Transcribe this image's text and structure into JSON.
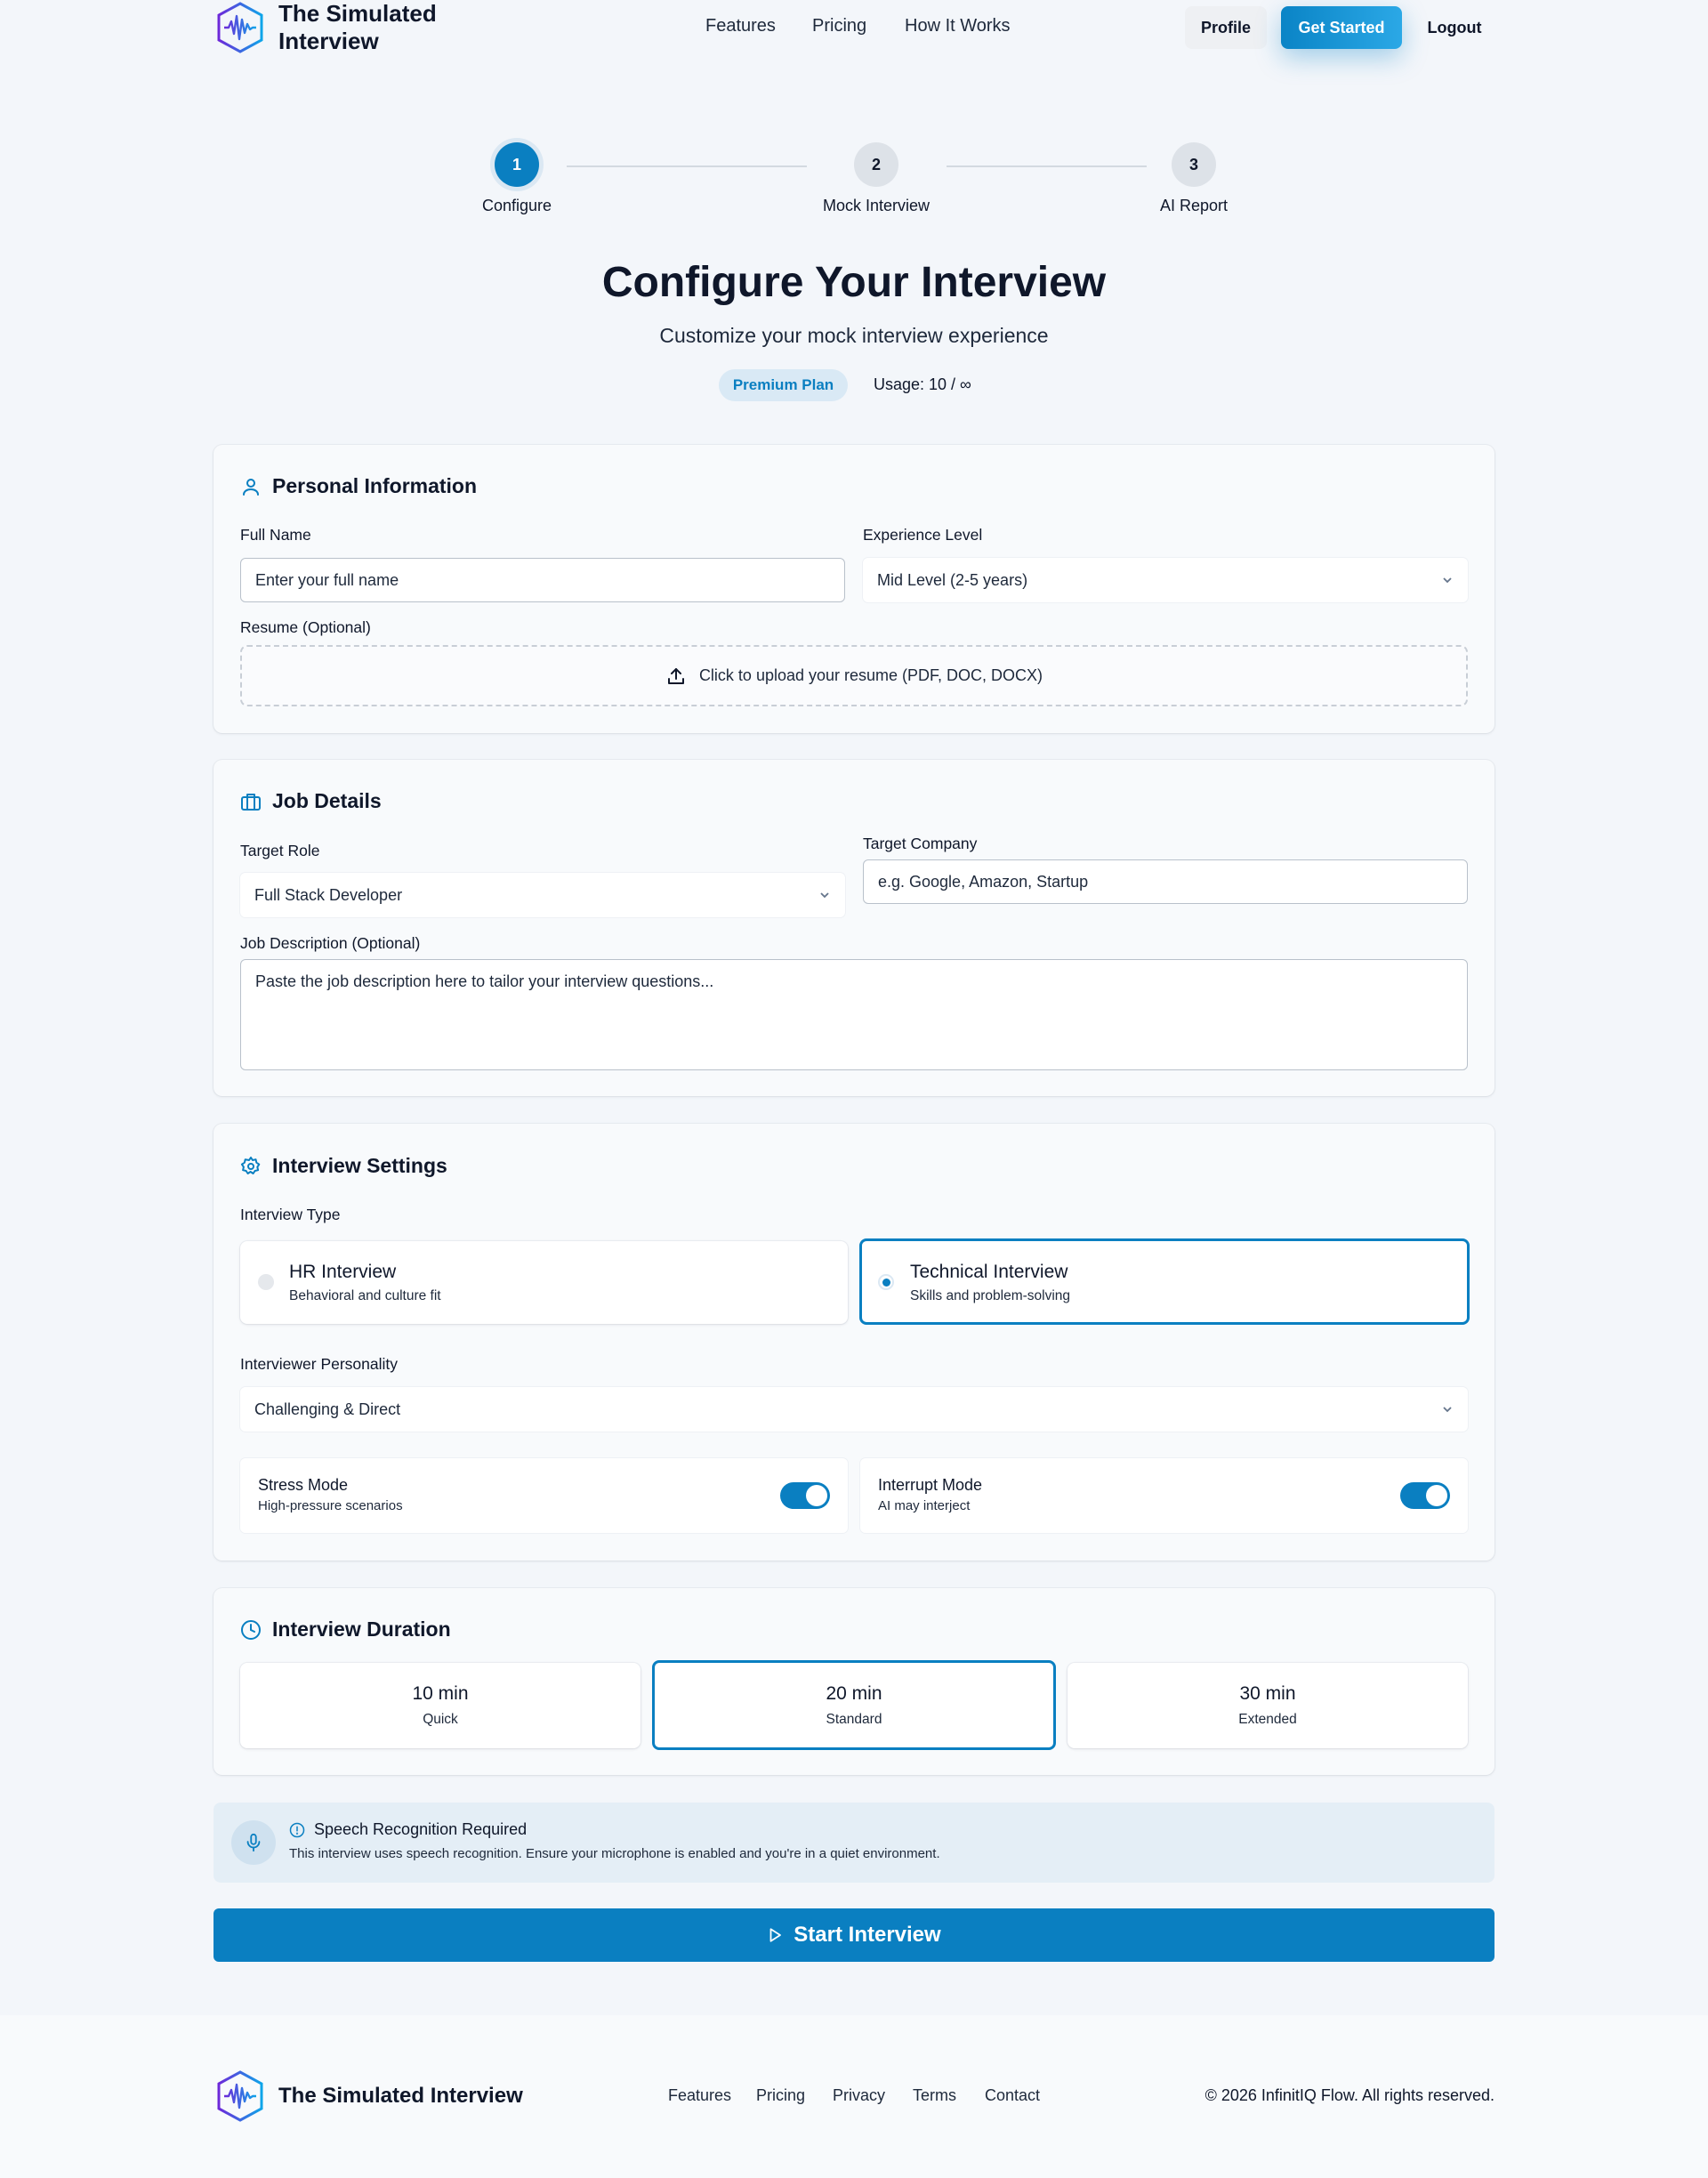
{
  "header": {
    "brand": "The Simulated Interview",
    "nav": [
      "Features",
      "Pricing",
      "How It Works"
    ],
    "profile_label": "Profile",
    "get_started_label": "Get Started",
    "logout_label": "Logout"
  },
  "stepper": {
    "steps": [
      {
        "number": "1",
        "label": "Configure",
        "active": true
      },
      {
        "number": "2",
        "label": "Mock Interview",
        "active": false
      },
      {
        "number": "3",
        "label": "AI Report",
        "active": false
      }
    ]
  },
  "page": {
    "title": "Configure Your Interview",
    "subtitle": "Customize your mock interview experience",
    "plan_badge": "Premium Plan",
    "usage": "Usage: 10 / ∞"
  },
  "personal": {
    "title": "Personal Information",
    "full_name_label": "Full Name",
    "full_name_placeholder": "Enter your full name",
    "experience_label": "Experience Level",
    "experience_value": "Mid Level (2-5 years)",
    "resume_label": "Resume (Optional)",
    "resume_upload_text": "Click to upload your resume (PDF, DOC, DOCX)"
  },
  "job": {
    "title": "Job Details",
    "role_label": "Target Role",
    "role_value": "Full Stack Developer",
    "company_label": "Target Company",
    "company_placeholder": "e.g. Google, Amazon, Startup",
    "description_label": "Job Description (Optional)",
    "description_placeholder": "Paste the job description here to tailor your interview questions..."
  },
  "settings": {
    "title": "Interview Settings",
    "type_label": "Interview Type",
    "types": [
      {
        "title": "HR Interview",
        "desc": "Behavioral and culture fit",
        "selected": false
      },
      {
        "title": "Technical Interview",
        "desc": "Skills and problem-solving",
        "selected": true
      }
    ],
    "personality_label": "Interviewer Personality",
    "personality_value": "Challenging & Direct",
    "toggles": [
      {
        "title": "Stress Mode",
        "desc": "High-pressure scenarios",
        "on": true
      },
      {
        "title": "Interrupt Mode",
        "desc": "AI may interject",
        "on": true
      }
    ]
  },
  "duration": {
    "title": "Interview Duration",
    "options": [
      {
        "value": "10 min",
        "label": "Quick",
        "selected": false
      },
      {
        "value": "20 min",
        "label": "Standard",
        "selected": true
      },
      {
        "value": "30 min",
        "label": "Extended",
        "selected": false
      }
    ]
  },
  "notice": {
    "title": "Speech Recognition Required",
    "text": "This interview uses speech recognition. Ensure your microphone is enabled and you're in a quiet environment."
  },
  "start_label": "Start Interview",
  "footer": {
    "brand": "The Simulated Interview",
    "links": [
      "Features",
      "Pricing",
      "Privacy",
      "Terms",
      "Contact"
    ],
    "copyright": "© 2026 InfinitIQ Flow. All rights reserved."
  },
  "colors": {
    "accent": "#0a7fc1",
    "background": "#f3f6fa"
  }
}
